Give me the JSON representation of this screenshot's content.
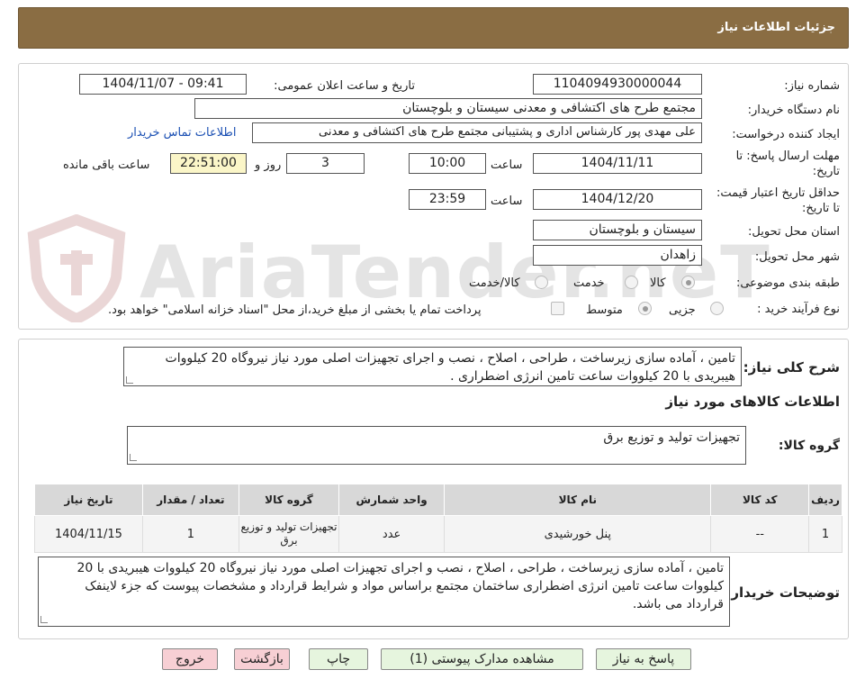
{
  "header": {
    "title": "جزئیات اطلاعات نیاز"
  },
  "watermark": {
    "text": "AriaTender.neT"
  },
  "form": {
    "need_number": {
      "label": "شماره نیاز:",
      "value": "1104094930000044"
    },
    "announce_datetime": {
      "label": "تاریخ و ساعت اعلان عمومی:",
      "value": "1404/11/07 - 09:41"
    },
    "buyer_org": {
      "label": "نام دستگاه خریدار:",
      "value": "مجتمع طرح های اکتشافی و معدنی سیستان و بلوچستان"
    },
    "requester": {
      "label": "ایجاد کننده درخواست:",
      "value": "علی مهدی پور کارشناس اداری و پشتیبانی مجتمع طرح های اکتشافی و معدنی"
    },
    "contact_link": "اطلاعات تماس خریدار",
    "reply_deadline": {
      "label": "مهلت ارسال پاسخ: تا تاریخ:",
      "date": "1404/11/11",
      "time_label": "ساعت",
      "time": "10:00",
      "days": "3",
      "days_label": "روز و",
      "remaining": "22:51:00",
      "remaining_label": "ساعت باقی مانده"
    },
    "price_validity": {
      "label": "حداقل تاریخ اعتبار قیمت: تا تاریخ:",
      "date": "1404/12/20",
      "time_label": "ساعت",
      "time": "23:59"
    },
    "delivery_province": {
      "label": "استان محل تحویل:",
      "value": "سیستان و بلوچستان"
    },
    "delivery_city": {
      "label": "شهر محل تحویل:",
      "value": "زاهدان"
    },
    "category": {
      "label": "طبقه بندی موضوعی:",
      "options": [
        "کالا",
        "خدمت",
        "کالا/خدمت"
      ],
      "selected": "کالا"
    },
    "purchase_type": {
      "label": "نوع فرآیند خرید :",
      "options": [
        "جزیی",
        "متوسط"
      ],
      "selected": "متوسط",
      "payment_note": "پرداخت تمام یا بخشی از مبلغ خرید،از محل \"اسناد خزانه اسلامی\" خواهد بود."
    }
  },
  "summary": {
    "label": "شرح کلی نیاز:",
    "value": "تامین ، آماده سازی زیرساخت ، طراحی ، اصلاح ، نصب و اجرای تجهیزات اصلی مورد نیاز نیروگاه 20 کیلووات هیبریدی با 20 کیلووات ساعت تامین انرژی اضطراری ."
  },
  "goods": {
    "section_title": "اطلاعات کالاهای مورد نیاز",
    "group_label": "گروه کالا:",
    "group_value": "تجهیزات تولید و توزیع برق",
    "columns": [
      "ردیف",
      "کد کالا",
      "نام کالا",
      "واحد شمارش",
      "گروه کالا",
      "تعداد / مقدار",
      "تاریخ نیاز"
    ],
    "rows": [
      [
        "1",
        "--",
        "پنل خورشیدی",
        "عدد",
        "تجهیزات تولید و توزیع برق",
        "1",
        "1404/11/15"
      ]
    ]
  },
  "buyer_notes": {
    "label": "توضیحات خریدار:",
    "value": "تامین ، آماده سازی زیرساخت ، طراحی ، اصلاح ، نصب و اجرای تجهیزات اصلی مورد نیاز نیروگاه 20 کیلووات هیبریدی با 20 کیلووات ساعت تامین انرژی اضطراری ساختمان مجتمع براساس مواد و شرایط قرارداد و مشخصات پیوست که جزء لاینفک قرارداد می باشد."
  },
  "buttons": {
    "reply": "پاسخ به نیاز",
    "attachments": "مشاهده مدارک پیوستی (1)",
    "print": "چاپ",
    "back": "بازگشت",
    "exit": "خروج"
  },
  "colors": {
    "header_bg": "#8a6d43",
    "exit_btn": "#f7cfd4",
    "action_btn": "#e6f5de",
    "remaining_box": "#fbf6c8"
  }
}
